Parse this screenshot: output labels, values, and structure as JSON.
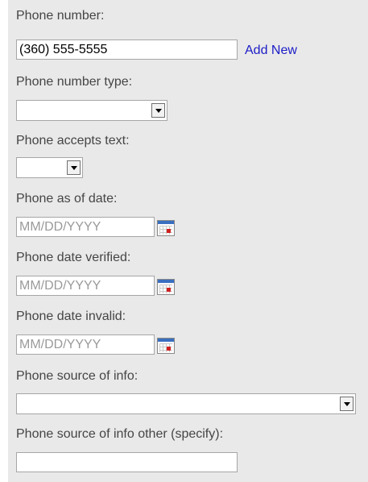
{
  "form": {
    "phone_number": {
      "label": "Phone number:",
      "value": "(360) 555-5555",
      "add_new": "Add New"
    },
    "phone_number_type": {
      "label": "Phone number type:",
      "value": ""
    },
    "phone_accepts_text": {
      "label": "Phone accepts text:",
      "value": ""
    },
    "phone_as_of_date": {
      "label": "Phone as of date:",
      "placeholder": "MM/DD/YYYY"
    },
    "phone_date_verified": {
      "label": "Phone date verified:",
      "placeholder": "MM/DD/YYYY"
    },
    "phone_date_invalid": {
      "label": "Phone date invalid:",
      "placeholder": "MM/DD/YYYY"
    },
    "phone_source_of_info": {
      "label": "Phone source of info:",
      "value": ""
    },
    "phone_source_other": {
      "label": "Phone source of info other (specify):",
      "value": ""
    }
  },
  "icons": {
    "dropdown": "chevron-down-icon",
    "calendar": "calendar-icon"
  }
}
